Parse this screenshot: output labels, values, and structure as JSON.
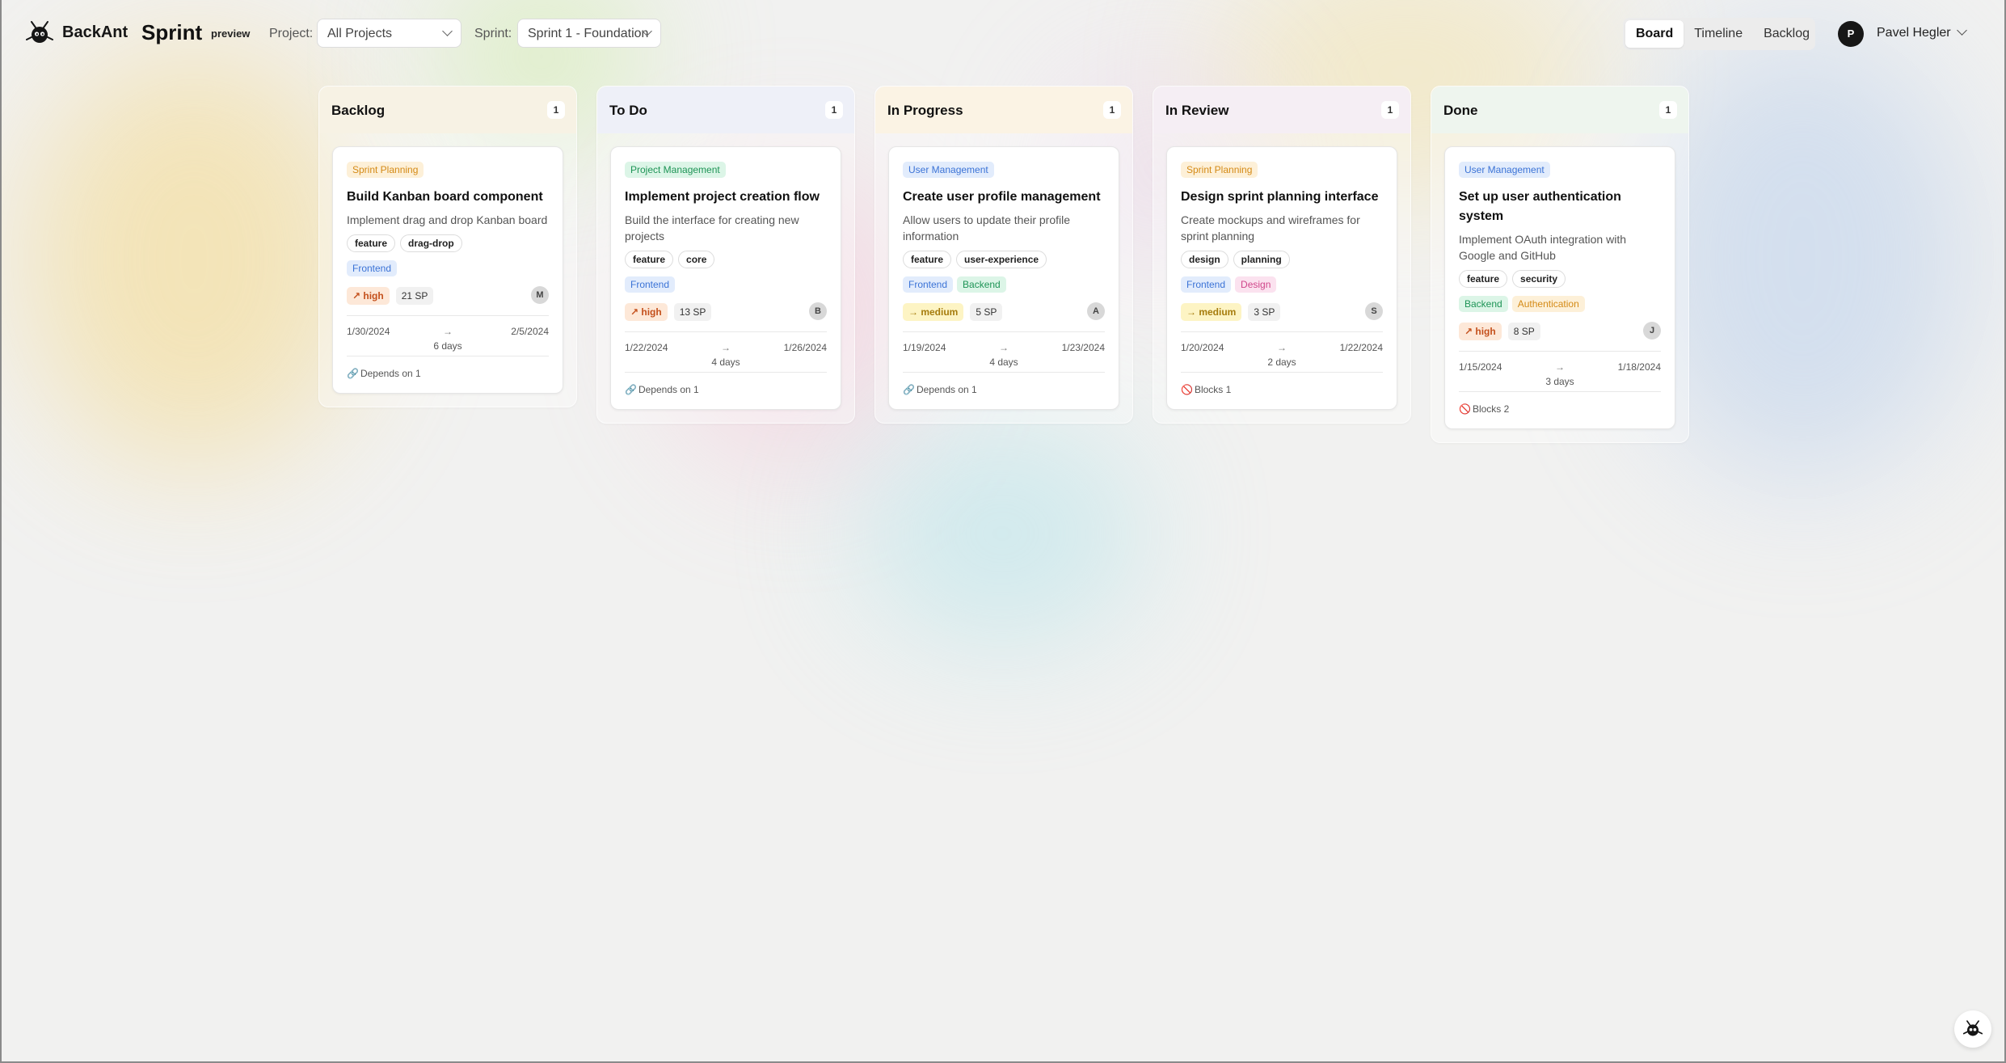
{
  "header": {
    "brand": "BackAnt",
    "page_title": "Sprint",
    "badge": "preview",
    "project_label": "Project:",
    "project_value": "All Projects",
    "sprint_label": "Sprint:",
    "sprint_value": "Sprint 1 - Foundation",
    "view_tabs": [
      "Board",
      "Timeline",
      "Backlog"
    ],
    "active_view": "Board",
    "user_initial": "P",
    "user_name": "Pavel Hegler"
  },
  "columns": [
    {
      "title": "Backlog",
      "count": "1",
      "card": {
        "epic": "Sprint Planning",
        "epic_color": "orange",
        "title": "Build Kanban board component",
        "description": "Implement drag and drop Kanban board",
        "tags": [
          "feature",
          "drag-drop"
        ],
        "components": [
          {
            "name": "Frontend",
            "color": "blue"
          }
        ],
        "priority": "↗ high",
        "priority_level": "high",
        "story_points": "21 SP",
        "assignee": "M",
        "start": "1/30/2024",
        "arrow": "→",
        "end": "2/5/2024",
        "duration": "6 days",
        "dependency_icon": "link-icon",
        "dependency": "Depends on 1"
      }
    },
    {
      "title": "To Do",
      "count": "1",
      "card": {
        "epic": "Project Management",
        "epic_color": "green",
        "title": "Implement project creation flow",
        "description": "Build the interface for creating new projects",
        "tags": [
          "feature",
          "core"
        ],
        "components": [
          {
            "name": "Frontend",
            "color": "blue"
          }
        ],
        "priority": "↗ high",
        "priority_level": "high",
        "story_points": "13 SP",
        "assignee": "B",
        "start": "1/22/2024",
        "arrow": "→",
        "end": "1/26/2024",
        "duration": "4 days",
        "dependency_icon": "link-icon",
        "dependency": "Depends on 1"
      }
    },
    {
      "title": "In Progress",
      "count": "1",
      "card": {
        "epic": "User Management",
        "epic_color": "blue",
        "title": "Create user profile management",
        "description": "Allow users to update their profile information",
        "tags": [
          "feature",
          "user-experience"
        ],
        "components": [
          {
            "name": "Frontend",
            "color": "blue"
          },
          {
            "name": "Backend",
            "color": "green"
          }
        ],
        "priority": "→ medium",
        "priority_level": "medium",
        "story_points": "5 SP",
        "assignee": "A",
        "start": "1/19/2024",
        "arrow": "→",
        "end": "1/23/2024",
        "duration": "4 days",
        "dependency_icon": "link-icon",
        "dependency": "Depends on 1"
      }
    },
    {
      "title": "In Review",
      "count": "1",
      "card": {
        "epic": "Sprint Planning",
        "epic_color": "orange",
        "title": "Design sprint planning interface",
        "description": "Create mockups and wireframes for sprint planning",
        "tags": [
          "design",
          "planning"
        ],
        "components": [
          {
            "name": "Frontend",
            "color": "blue"
          },
          {
            "name": "Design",
            "color": "pink"
          }
        ],
        "priority": "→ medium",
        "priority_level": "medium",
        "story_points": "3 SP",
        "assignee": "S",
        "start": "1/20/2024",
        "arrow": "→",
        "end": "1/22/2024",
        "duration": "2 days",
        "dependency_icon": "blocked-icon",
        "dependency": "Blocks 1"
      }
    },
    {
      "title": "Done",
      "count": "1",
      "card": {
        "epic": "User Management",
        "epic_color": "blue",
        "title": "Set up user authentication system",
        "description": "Implement OAuth integration with Google and GitHub",
        "tags": [
          "feature",
          "security"
        ],
        "components": [
          {
            "name": "Backend",
            "color": "green"
          },
          {
            "name": "Authentication",
            "color": "orange"
          }
        ],
        "priority": "↗ high",
        "priority_level": "high",
        "story_points": "8 SP",
        "assignee": "J",
        "start": "1/15/2024",
        "arrow": "→",
        "end": "1/18/2024",
        "duration": "3 days",
        "dependency_icon": "blocked-icon",
        "dependency": "Blocks 2"
      }
    }
  ],
  "colors": {
    "column_head_tints": [
      "#f7f2e4",
      "#eef0f8",
      "#fbf3e4",
      "#f5eef4",
      "#eef5ee"
    ]
  }
}
